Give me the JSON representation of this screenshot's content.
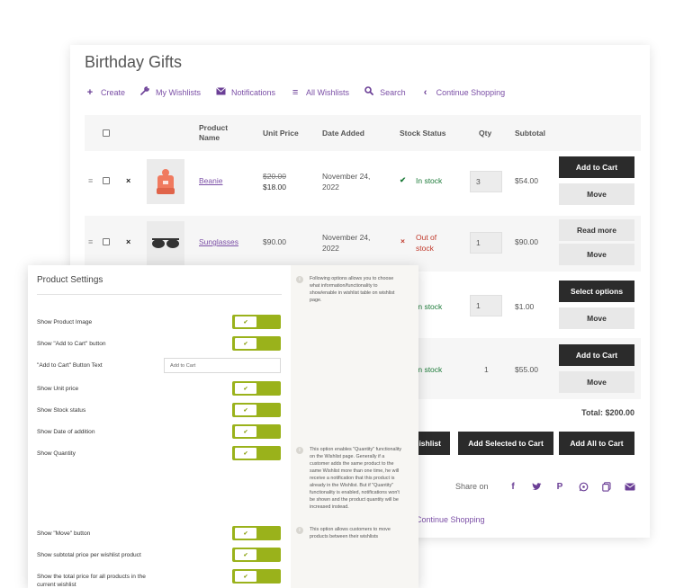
{
  "wishlist": {
    "title": "Birthday Gifts",
    "nav": [
      {
        "icon": "plus-icon",
        "glyph": "+",
        "label": "Create"
      },
      {
        "icon": "wrench-icon",
        "glyph": "✎",
        "label": "My Wishlists"
      },
      {
        "icon": "envelope-icon",
        "glyph": "✉",
        "label": "Notifications"
      },
      {
        "icon": "list-icon",
        "glyph": "≡",
        "label": "All Wishlists"
      },
      {
        "icon": "search-icon",
        "glyph": "⌕",
        "label": "Search"
      },
      {
        "icon": "chevron-left-icon",
        "glyph": "‹",
        "label": "Continue Shopping"
      }
    ],
    "columns": {
      "product_name": "Product Name",
      "unit_price": "Unit Price",
      "date_added": "Date Added",
      "stock_status": "Stock Status",
      "qty": "Qty",
      "subtotal": "Subtotal"
    },
    "rows": [
      {
        "name": "Beanie",
        "old_price": "$20.00",
        "price": "$18.00",
        "date": "November 24, 2022",
        "stock": "In stock",
        "qty": "3",
        "subtotal": "$54.00",
        "primary": "Add to Cart",
        "secondary": "Move"
      },
      {
        "name": "Sunglasses",
        "old_price": "",
        "price": "$90.00",
        "date": "November 24, 2022",
        "stock": "Out of stock",
        "qty": "1",
        "subtotal": "$90.00",
        "primary": "Read more",
        "secondary": "Move"
      },
      {
        "name": "",
        "old_price": "",
        "price": "",
        "date": "",
        "stock": "In stock",
        "qty": "1",
        "subtotal": "$1.00",
        "primary": "Select options",
        "secondary": "Move"
      },
      {
        "name": "",
        "old_price": "",
        "price": "",
        "date": "",
        "stock": "In stock",
        "qty": "1",
        "subtotal": "$55.00",
        "primary": "Add to Cart",
        "secondary": "Move"
      }
    ],
    "total": "Total: $200.00",
    "bottom_buttons": {
      "partial": "ishlist",
      "add_selected": "Add Selected to Cart",
      "add_all": "Add All to Cart"
    },
    "share_label": "Share on",
    "share_icons": [
      "facebook-icon",
      "twitter-icon",
      "pinterest-icon",
      "whatsapp-icon",
      "copy-icon",
      "email-icon"
    ],
    "continue_shopping": "Continue Shopping"
  },
  "settings": {
    "title": "Product Settings",
    "items": [
      {
        "label": "Show Product Image",
        "type": "toggle"
      },
      {
        "label": "Show \"Add to Cart\" button",
        "type": "toggle"
      },
      {
        "label": "\"Add to Cart\" Button Text",
        "type": "text",
        "value": "Add to Cart"
      },
      {
        "label": "Show Unit price",
        "type": "toggle"
      },
      {
        "label": "Show Stock status",
        "type": "toggle"
      },
      {
        "label": "Show Date of addition",
        "type": "toggle"
      },
      {
        "label": "Show Quantity",
        "type": "toggle"
      },
      {
        "label": "Show \"Move\" button",
        "type": "toggle"
      },
      {
        "label": "Show subtotal price per wishlist product",
        "type": "toggle"
      },
      {
        "label": "Show the total price for all products in the current wishlist",
        "type": "toggle"
      }
    ],
    "info": [
      "Following options allows you to choose what information/functionality to show/enable in wishlist table on wishlist page.",
      "This option enables \"Quantity\" functionality on the Wishlist page. Generally if a customer adds the same product to the same Wishlist more than one time, he will receive a notification that this product is already in the Wishlist. But if \"Quantity\" functionality is enabled, notifications won't be shown and the product quantity will be increased instead.",
      "This option allows customers to move products between their wishlists"
    ],
    "accent": "#9ab21b"
  }
}
